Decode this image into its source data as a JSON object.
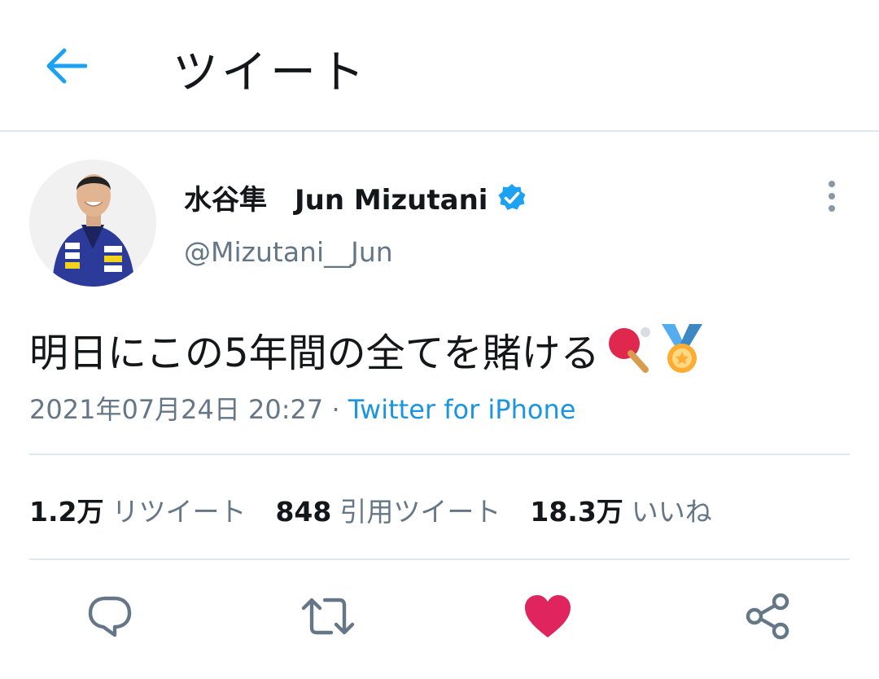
{
  "header": {
    "title": "ツイート",
    "back_icon": "back-arrow-icon"
  },
  "tweet": {
    "display_name": "水谷隼　Jun Mizutani",
    "handle": "@Mizutani__Jun",
    "verified": true,
    "text": "明日にこの5年間の全てを賭ける",
    "emojis": [
      "ping-pong-paddle-icon",
      "sports-medal-icon"
    ],
    "timestamp": "2021年07月24日 20:27",
    "separator": "·",
    "source": "Twitter for iPhone"
  },
  "stats": {
    "retweets": {
      "count": "1.2万",
      "label": "リツイート"
    },
    "quotes": {
      "count": "848",
      "label": "引用ツイート"
    },
    "likes": {
      "count": "18.3万",
      "label": "いいね"
    }
  },
  "actions": [
    "reply-icon",
    "retweet-icon",
    "heart-icon",
    "share-icon"
  ],
  "colors": {
    "accent": "#1da1f2",
    "like": "#e0245e",
    "secondary": "#657786",
    "divider": "#e1e8ed"
  }
}
